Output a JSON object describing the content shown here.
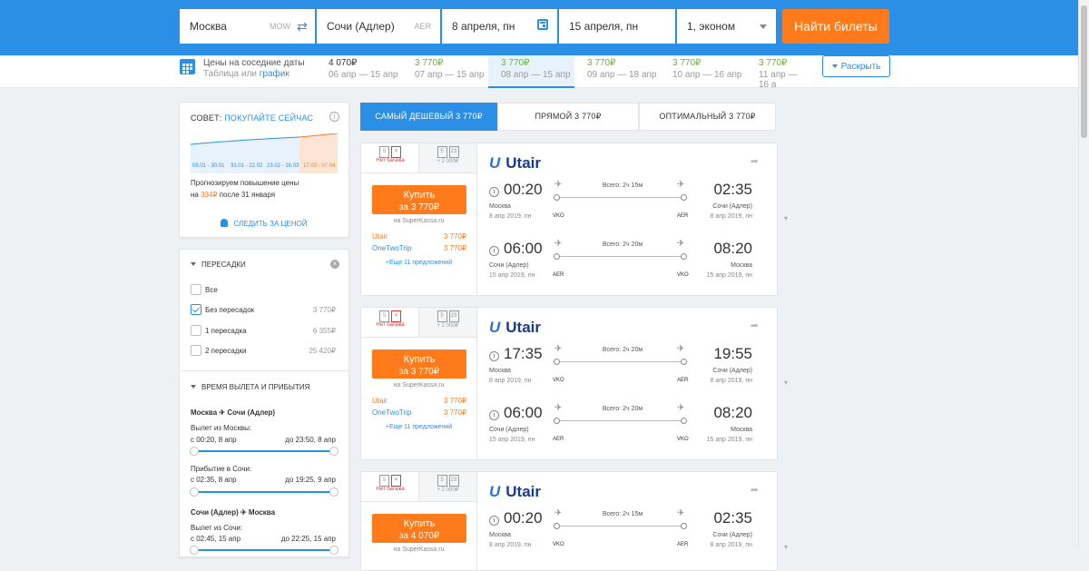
{
  "search": {
    "origin": "Москва",
    "origin_code": "MOW",
    "destination": "Сочи (Адлер)",
    "destination_code": "AER",
    "date_there": "8 апреля, пн",
    "date_back": "15 апреля, пн",
    "passengers": "1, эконом",
    "submit": "Найти билеты"
  },
  "nearby": {
    "title": "Цены на соседние даты",
    "sub_prefix": "Таблица или",
    "sub_link": "график",
    "expand": "Раскрыть",
    "dates": [
      {
        "price": "4 070₽",
        "dates": "06 апр — 15 апр",
        "green": false
      },
      {
        "price": "3 770₽",
        "dates": "07 апр — 15 апр",
        "green": true
      },
      {
        "price": "3 770₽",
        "dates": "08 апр — 15 апр",
        "green": true
      },
      {
        "price": "3 770₽",
        "dates": "09 апр — 18 апр",
        "green": true
      },
      {
        "price": "3 770₽",
        "dates": "10 апр — 16 апр",
        "green": true
      },
      {
        "price": "3 770₽",
        "dates": "11 апр — 16 а",
        "green": true
      }
    ]
  },
  "tip": {
    "prefix": "СОВЕТ:",
    "action": "ПОКУПАЙТЕ СЕЙЧАС",
    "chart_labels": [
      "09.01 - 30.01",
      "31.01 - 22.02",
      "23.02 - 16.03",
      "17.03 - 07.04"
    ],
    "forecast_line1": "Прогнозируем повышение цены",
    "forecast_line2_pre": "на",
    "forecast_amount": "334₽",
    "forecast_line2_post": "после 31 января",
    "follow": "СЛЕДИТЬ ЗА ЦЕНОЙ"
  },
  "filters": {
    "stops_title": "ПЕРЕСАДКИ",
    "stops": [
      {
        "label": "Все",
        "price": "",
        "checked": false
      },
      {
        "label": "Без пересадок",
        "price": "3 770₽",
        "checked": true
      },
      {
        "label": "1 пересадка",
        "price": "6 355₽",
        "checked": false
      },
      {
        "label": "2 пересадки",
        "price": "25 420₽",
        "checked": false
      }
    ],
    "time_title": "ВРЕМЯ ВЫЛЕТА И ПРИБЫТИЯ",
    "route1": {
      "from": "Москва",
      "to": "Сочи (Адлер)"
    },
    "dep_label_1": "Вылет из Москвы:",
    "dep_from_1": "с 00:20, 8 апр",
    "dep_to_1": "до 23:50, 8 апр",
    "arr_label_1": "Прибытие в Сочи:",
    "arr_from_1": "с 02:35, 8 апр",
    "arr_to_1": "до 19:25, 9 апр",
    "route2": {
      "from": "Сочи (Адлер)",
      "to": "Москва"
    },
    "dep_label_2": "Вылет из Сочи:",
    "dep_from_2": "с 02:45, 15 апр",
    "dep_to_2": "до 22:25, 15 апр"
  },
  "sort_tabs": [
    {
      "label": "САМЫЙ ДЕШЕВЫЙ 3 770₽",
      "active": true
    },
    {
      "label": "ПРЯМОЙ 3 770₽",
      "active": false
    },
    {
      "label": "ОПТИМАЛЬНЫЙ 3 770₽",
      "active": false
    }
  ],
  "results": [
    {
      "no_bag": "Нет багажа",
      "bag_extra": "+ 2 000₽",
      "bag_n1": "5",
      "bag_n2": "23",
      "buy_label": "Купить",
      "buy_price": "за 3 770₽",
      "via": "на SuperKassa.ru",
      "agents": [
        {
          "name": "Utair",
          "price": "3 770₽"
        },
        {
          "name": "OneTwoTrip",
          "price": "3 770₽"
        }
      ],
      "more": "+Еще 11 предложений",
      "airline": "Utair",
      "segments": [
        {
          "dep": "00:20",
          "arr": "02:35",
          "from_city": "Москва",
          "from_date": "8 апр 2019, пн",
          "to_city": "Сочи (Адлер)",
          "to_date": "8 апр 2019, пн",
          "total": "Всего: 2ч 15м",
          "from_code": "VKO",
          "to_code": "AER"
        },
        {
          "dep": "06:00",
          "arr": "08:20",
          "from_city": "Сочи (Адлер)",
          "from_date": "15 апр 2019, пн",
          "to_city": "Москва",
          "to_date": "15 апр 2019, пн",
          "total": "Всего: 2ч 20м",
          "from_code": "AER",
          "to_code": "VKO"
        }
      ]
    },
    {
      "no_bag": "Нет багажа",
      "bag_extra": "+ 2 000₽",
      "bag_n1": "5",
      "bag_n2": "23",
      "buy_label": "Купить",
      "buy_price": "за 3 770₽",
      "via": "на SuperKassa.ru",
      "agents": [
        {
          "name": "Utair",
          "price": "3 770₽"
        },
        {
          "name": "OneTwoTrip",
          "price": "3 770₽"
        }
      ],
      "more": "+Еще 11 предложений",
      "airline": "Utair",
      "segments": [
        {
          "dep": "17:35",
          "arr": "19:55",
          "from_city": "Москва",
          "from_date": "8 апр 2019, пн",
          "to_city": "Сочи (Адлер)",
          "to_date": "8 апр 2019, пн",
          "total": "Всего: 2ч 20м",
          "from_code": "VKO",
          "to_code": "AER"
        },
        {
          "dep": "06:00",
          "arr": "08:20",
          "from_city": "Сочи (Адлер)",
          "from_date": "15 апр 2019, пн",
          "to_city": "Москва",
          "to_date": "15 апр 2019, пн",
          "total": "Всего: 2ч 20м",
          "from_code": "AER",
          "to_code": "VKO"
        }
      ]
    },
    {
      "no_bag": "Нет багажа",
      "bag_extra": "+ 2 000₽",
      "bag_n1": "5",
      "bag_n2": "23",
      "buy_label": "Купить",
      "buy_price": "за 4 070₽",
      "via": "на SuperKassa.ru",
      "airline": "Utair",
      "segments": [
        {
          "dep": "00:20",
          "arr": "02:35",
          "from_city": "Москва",
          "from_date": "8 апр 2019, пн",
          "to_city": "Сочи (Адлер)",
          "to_date": "8 апр 2019, пн",
          "total": "Всего: 2ч 15м",
          "from_code": "VKO",
          "to_code": "AER"
        }
      ]
    }
  ],
  "colors": {
    "brand": "#2b8fe6",
    "accent": "#ff7a1a",
    "green": "#6bb33f"
  }
}
